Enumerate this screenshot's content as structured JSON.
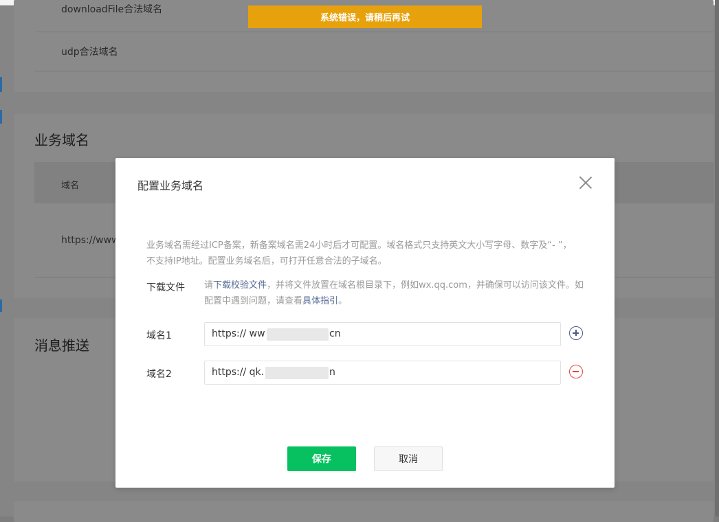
{
  "background": {
    "row_download_file": "downloadFile合法域名",
    "row_udp": "udp合法域名",
    "section_business_domain": "业务域名",
    "table_header_domain": "域名",
    "row_https": "https://www",
    "section_message_push": "消息推送"
  },
  "toast": {
    "text": "系统错误，请稍后再试"
  },
  "dialog": {
    "title": "配置业务域名",
    "description": "业务域名需经过ICP备案，新备案域名需24小时后才可配置。域名格式只支持英文大小写字母、数字及“- ”，不支持IP地址。配置业务域名后，可打开任意合法的子域名。",
    "download": {
      "label": "下载文件",
      "text_before": "请",
      "link_download": "下载校验文件",
      "text_middle": "，并将文件放置在域名根目录下，例如wx.qq.com，并确保可以访问该文件。如配置中遇到问题，请查看",
      "link_guide": "具体指引",
      "text_after": "。"
    },
    "domains": [
      {
        "label": "域名1",
        "prefix": "https:// ww",
        "suffix": "cn"
      },
      {
        "label": "域名2",
        "prefix": "https:// qk.",
        "suffix": "n"
      }
    ],
    "save_label": "保存",
    "cancel_label": "取消"
  },
  "icons": [
    "close-icon",
    "plus-circle-icon",
    "minus-circle-icon"
  ],
  "colors": {
    "primary": "#07c160",
    "toast": "#e7a10c",
    "danger": "#e64340",
    "link": "#576b95"
  }
}
